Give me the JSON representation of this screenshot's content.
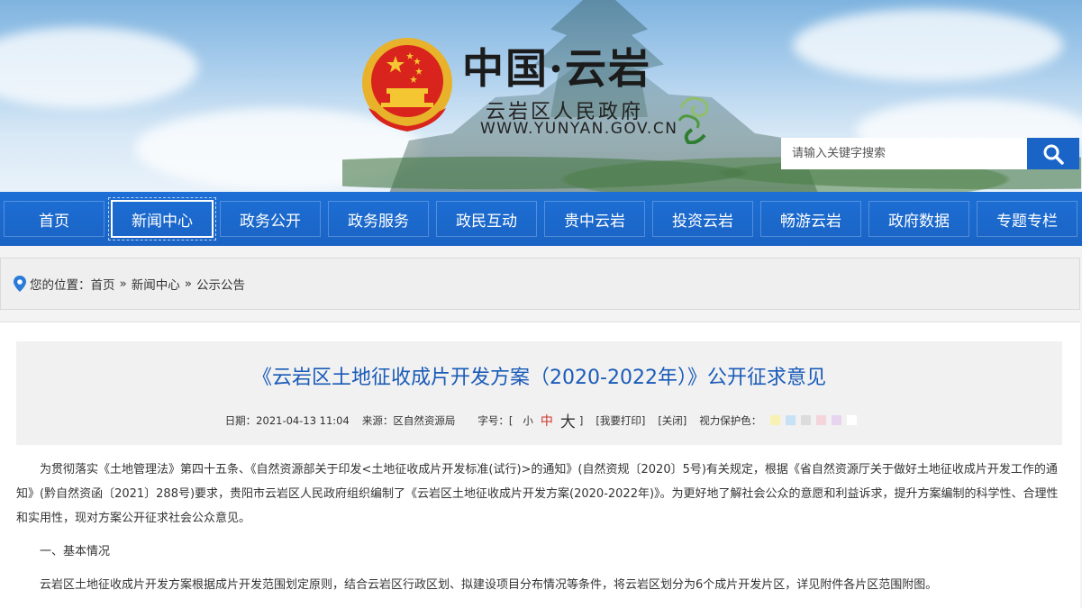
{
  "header": {
    "site_title": "中国·云岩",
    "site_subtitle": "云岩区人民政府",
    "site_url": "WWW.YUNYAN.GOV.CN",
    "search_placeholder": "请输入关键字搜索",
    "search_icon": "search-icon"
  },
  "nav": {
    "items": [
      {
        "label": "首页"
      },
      {
        "label": "新闻中心",
        "active": true
      },
      {
        "label": "政务公开"
      },
      {
        "label": "政务服务"
      },
      {
        "label": "政民互动"
      },
      {
        "label": "贵中云岩"
      },
      {
        "label": "投资云岩"
      },
      {
        "label": "畅游云岩"
      },
      {
        "label": "政府数据"
      },
      {
        "label": "专题专栏"
      }
    ]
  },
  "breadcrumb": {
    "prefix": "您的位置：",
    "items": [
      "首页",
      "新闻中心",
      "公示公告"
    ],
    "separator": "»"
  },
  "article": {
    "title": "《云岩区土地征收成片开发方案（2020-2022年）》公开征求意见",
    "date_label": "日期：2021-04-13 11:04",
    "source_label": "来源：区自然资源局",
    "font_size_label": "字号：[",
    "font_small": "小",
    "font_medium": "中",
    "font_large": "大",
    "font_close": "]",
    "print_label": "[我要打印]",
    "close_label": "[关闭]",
    "eye_label": "视力保护色：",
    "eye_colors": [
      "#f7f2b3",
      "#c8e2f5",
      "#dcdcdc",
      "#f5d5dc",
      "#e7d5ef",
      "#ffffff"
    ],
    "paragraphs": [
      "为贯彻落实《土地管理法》第四十五条、《自然资源部关于印发<土地征收成片开发标准(试行)>的通知》(自然资规〔2020〕5号)有关规定，根据《省自然资源厅关于做好土地征收成片开发工作的通知》(黔自然资函〔2021〕288号)要求，贵阳市云岩区人民政府组织编制了《云岩区土地征收成片开发方案(2020-2022年)》。为更好地了解社会公众的意愿和利益诉求，提升方案编制的科学性、合理性和实用性，现对方案公开征求社会公众意见。",
      "一、基本情况",
      "云岩区土地征收成片开发方案根据成片开发范围划定原则，结合云岩区行政区划、拟建设项目分布情况等条件，将云岩区划分为6个成片开发片区，详见附件各片区范围附图。"
    ]
  }
}
